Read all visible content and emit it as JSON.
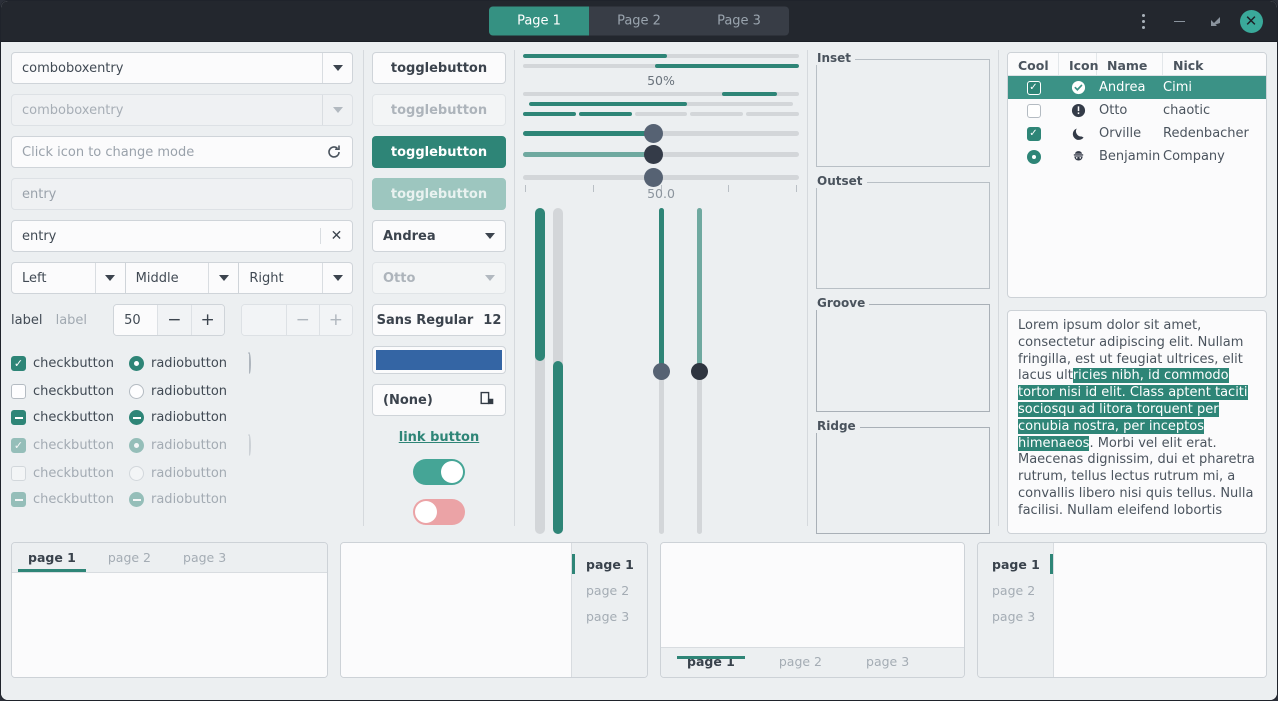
{
  "header": {
    "tabs": [
      {
        "label": "Page 1",
        "active": true
      },
      {
        "label": "Page 2",
        "active": false
      },
      {
        "label": "Page 3",
        "active": false
      }
    ],
    "menu_icon": "menu-dots-icon",
    "minimize_icon": "minimize-icon",
    "maximize_icon": "maximize-icon",
    "close_icon": "close-icon",
    "close_color": "#3aa99a"
  },
  "entries": {
    "combo_entry_1": "comboboxentry",
    "combo_entry_2": "comboboxentry",
    "mode_entry_placeholder": "Click icon to change mode",
    "mode_entry_icon": "refresh-icon",
    "entry_disabled_placeholder": "entry",
    "entry_value": "entry",
    "entry_clear_icon": "clear-icon"
  },
  "combos": {
    "left": "Left",
    "middle": "Middle",
    "right": "Right"
  },
  "spinners": {
    "label_1": "label",
    "label_2": "label",
    "value": "50",
    "minus": "−",
    "plus": "+",
    "value_disabled": ""
  },
  "checks": {
    "rows": [
      {
        "check": "checkbutton",
        "radio": "radiobutton",
        "state": "on",
        "disabled": false,
        "spinner": true
      },
      {
        "check": "checkbutton",
        "radio": "radiobutton",
        "state": "off",
        "disabled": false,
        "spinner": false
      },
      {
        "check": "checkbutton",
        "radio": "radiobutton",
        "state": "mixed",
        "disabled": false,
        "spinner": false
      },
      {
        "check": "checkbutton",
        "radio": "radiobutton",
        "state": "on",
        "disabled": true,
        "spinner": true
      },
      {
        "check": "checkbutton",
        "radio": "radiobutton",
        "state": "off",
        "disabled": true,
        "spinner": false
      },
      {
        "check": "checkbutton",
        "radio": "radiobutton",
        "state": "mixed",
        "disabled": true,
        "spinner": false
      }
    ]
  },
  "buttons": {
    "toggle_1": "togglebutton",
    "toggle_2": "togglebutton",
    "toggle_3": "togglebutton",
    "toggle_4": "togglebutton",
    "combo_name": "Andrea",
    "combo_name_disabled": "Otto",
    "font_name": "Sans Regular",
    "font_size": "12",
    "color_value": "#3465a4",
    "file_button": "(None)",
    "file_icon": "document-open-icon",
    "link_button": "link button",
    "switch_on": "on",
    "switch_off": "off",
    "accent": "#2e8577"
  },
  "progress": {
    "bar1_pct": 52,
    "bar2_pct": 52,
    "bar2_inverted": true,
    "percent_label": "50%",
    "bar3_pulse_start": 76,
    "bar3_pulse_width": 20,
    "bar4_pct": 60,
    "segments": [
      true,
      true,
      false,
      false,
      false
    ]
  },
  "scales": {
    "h1_value": 47,
    "h2_value": 47,
    "h3_value": 47,
    "h3_marks": 5,
    "v_value_label": "50.0",
    "v1_value": 50,
    "v2_value": 50,
    "vprog1_pct": 47,
    "vprog2_pct": 47
  },
  "frames": [
    {
      "title": "Inset"
    },
    {
      "title": "Outset"
    },
    {
      "title": "Groove"
    },
    {
      "title": "Ridge"
    }
  ],
  "treeview": {
    "columns": [
      "Cool",
      "Icon",
      "Name",
      "Nick"
    ],
    "rows": [
      {
        "cool": "checked",
        "icon": "check-circle-icon",
        "name": "Andrea",
        "nick": "Cimi",
        "selected": true
      },
      {
        "cool": "unchecked",
        "icon": "exclamation-circle-icon",
        "name": "Otto",
        "nick": "chaotic",
        "selected": false
      },
      {
        "cool": "checked",
        "icon": "moon-icon",
        "name": "Orville",
        "nick": "Redenbacher",
        "selected": false
      },
      {
        "cool": "radio",
        "icon": "face-icon",
        "name": "Benjamin",
        "nick": "Company",
        "selected": false
      }
    ]
  },
  "textview": {
    "pre": "Lorem ipsum dolor sit amet, consectetur adipiscing elit.\nNullam fringilla, est ut feugiat ultrices, elit lacus ult",
    "highlight": "ricies nibh, id commodo tortor nisi id elit.\nClass aptent taciti sociosqu ad litora torquent per conubia nostra, per inceptos himenaeos",
    "post": ".\nMorbi vel elit erat. Maecenas dignissim, dui et pharetra rutrum, tellus lectus rutrum mi, a convallis libero nisi quis tellus.\nNulla facilisi. Nullam eleifend lobortis"
  },
  "notebooks": [
    {
      "position": "top",
      "tabs": [
        "page 1",
        "page 2",
        "page 3"
      ],
      "active": 0
    },
    {
      "position": "right",
      "tabs": [
        "page 1",
        "page 2",
        "page 3"
      ],
      "active": 0
    },
    {
      "position": "bottom",
      "tabs": [
        "page 1",
        "page 2",
        "page 3"
      ],
      "active": 0
    },
    {
      "position": "left",
      "tabs": [
        "page 1",
        "page 2",
        "page 3"
      ],
      "active": 0
    }
  ]
}
